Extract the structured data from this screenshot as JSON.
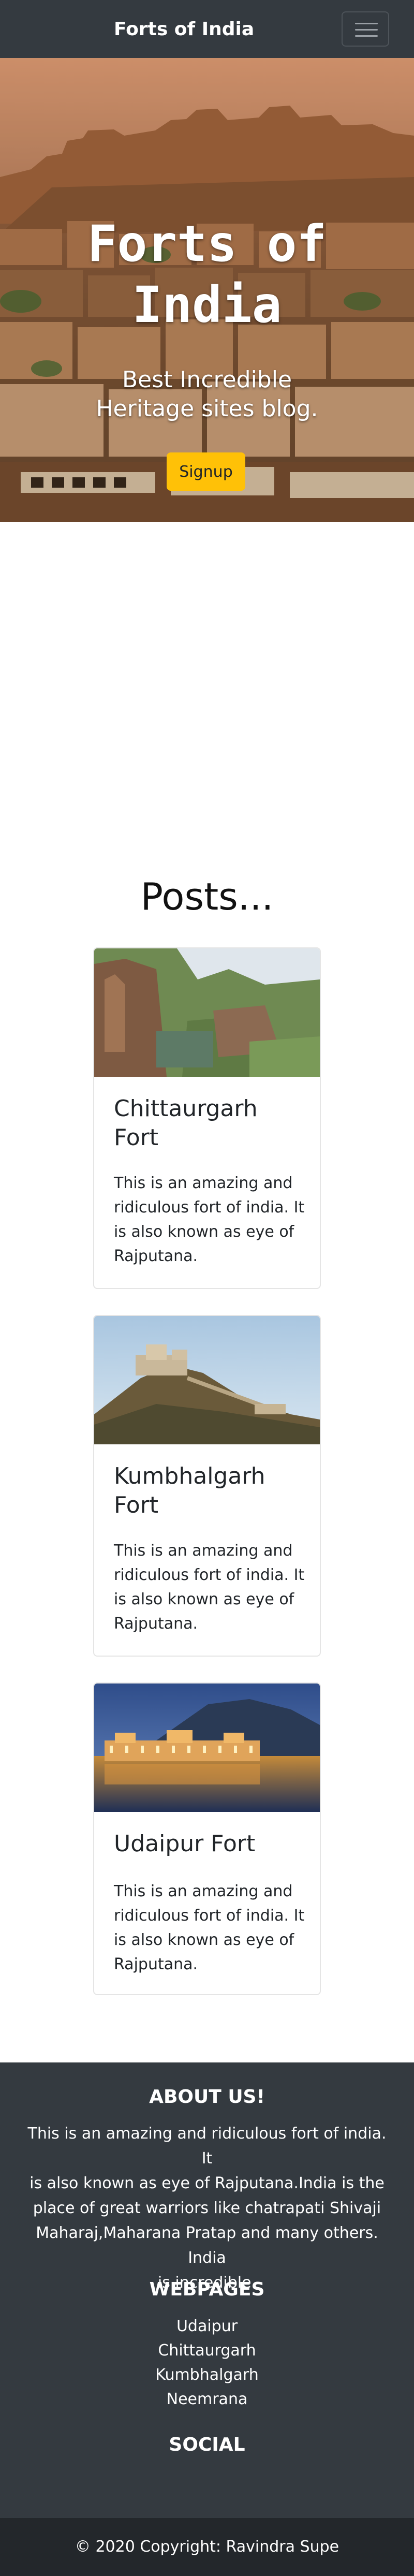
{
  "navbar": {
    "brand": "Forts of India",
    "toggler_icon": "hamburger-menu-icon"
  },
  "hero": {
    "title_line1": "Forts of",
    "title_line2": "India",
    "subtitle_line1": "Best Incredible",
    "subtitle_line2": "Heritage sites blog.",
    "signup_label": "Signup",
    "signup_color": "#ffc107"
  },
  "posts": {
    "heading": "Posts...",
    "items": [
      {
        "title_line1": "Chittaurgarh",
        "title_line2": "Fort",
        "text_lines": [
          "This is an amazing and",
          "ridiculous fort of india. It",
          "is also known as eye of",
          "Rajputana."
        ]
      },
      {
        "title_line1": "Kumbhalgarh",
        "title_line2": "Fort",
        "text_lines": [
          "This is an amazing and",
          "ridiculous fort of india. It",
          "is also known as eye of",
          "Rajputana."
        ]
      },
      {
        "title_line1": "Udaipur Fort",
        "title_line2": "",
        "text_lines": [
          "This is an amazing and",
          "ridiculous fort of india. It",
          "is also known as eye of",
          "Rajputana."
        ]
      }
    ]
  },
  "footer": {
    "about_heading": "ABOUT US!",
    "about_lines": [
      "This is an amazing and ridiculous fort of india. It",
      "is also known as eye of Rajputana.India is the",
      "place of great warriors like chatrapati Shivaji",
      "Maharaj,Maharana Pratap and many others. India",
      "is incredible."
    ],
    "webpages_heading": "WEBPAGES",
    "webpages": [
      "Udaipur",
      "Chittaurgarh",
      "Kumbhalgarh",
      "Neemrana"
    ],
    "social_heading": "SOCIAL",
    "copyright": "© 2020 Copyright: Ravindra Supe"
  },
  "colors": {
    "navbar_bg": "#343a40",
    "footer_bg": "#343a40",
    "copyright_bg": "#23272b",
    "accent": "#ffc107"
  }
}
